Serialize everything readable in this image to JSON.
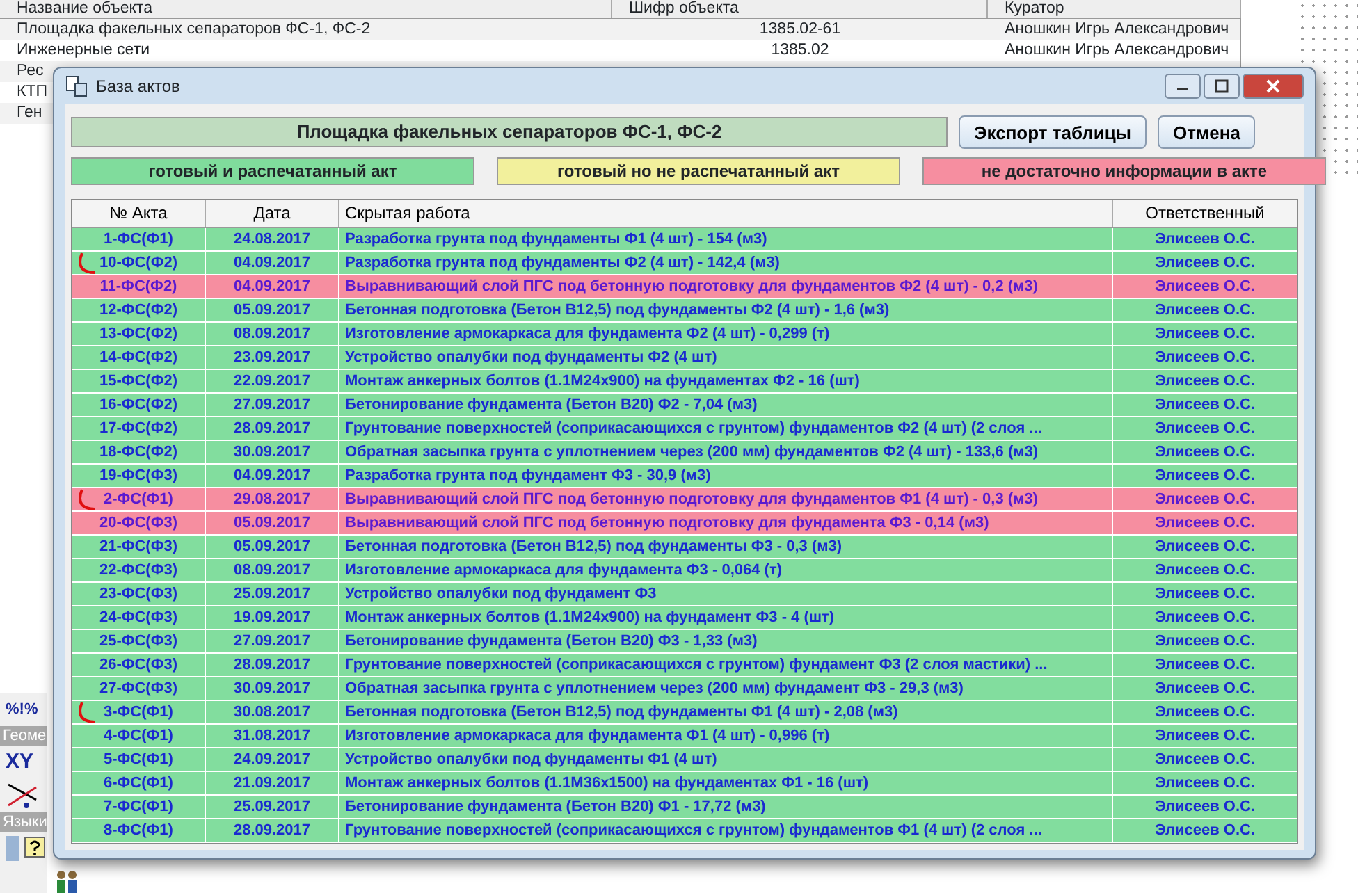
{
  "background_app": {
    "objects_table": {
      "columns": [
        "Название объекта",
        "Шифр объекта",
        "Куратор"
      ],
      "rows": [
        {
          "name": "Площадка факельных сепараторов ФС-1, ФС-2",
          "code": "1385.02-61",
          "curator": "Аношкин Игрь Александрович"
        },
        {
          "name": "Инженерные сети",
          "code": "1385.02",
          "curator": "Аношкин Игрь Александрович"
        },
        {
          "name": "Рес"
        },
        {
          "name": "КТП"
        },
        {
          "name": "Ген"
        }
      ]
    },
    "side_panel": {
      "formula_label": "%!%",
      "geometry_header": "Геоме",
      "xy_label": "XY",
      "languages_header": "Языки"
    }
  },
  "dialog": {
    "title": "База актов",
    "object_title": "Площадка факельных сепараторов ФС-1, ФС-2",
    "buttons": [
      "Экспорт таблицы",
      "Отмена"
    ],
    "legend": [
      {
        "label": "готовый и распечатанный акт",
        "color": "#80dc9c"
      },
      {
        "label": "готовый но не распечатанный акт",
        "color": "#f2f09c"
      },
      {
        "label": "не достаточно информации в акте",
        "color": "#f68ea0"
      }
    ],
    "table": {
      "columns": [
        "№ Акта",
        "Дата",
        "Скрытая работа",
        "Ответственный"
      ],
      "rows": [
        {
          "act": "1-ФС(Ф1)",
          "date": "24.08.2017",
          "work": "Разработка грунта под фундаменты Ф1 (4 шт) - 154 (м3)",
          "responsible": "Элисеев О.С.",
          "kind": "ready",
          "red_mark": false
        },
        {
          "act": "10-ФС(Ф2)",
          "date": "04.09.2017",
          "work": "Разработка грунта под фундаменты Ф2 (4 шт) - 142,4 (м3)",
          "responsible": "Элисеев О.С.",
          "kind": "ready",
          "red_mark": true
        },
        {
          "act": "11-ФС(Ф2)",
          "date": "04.09.2017",
          "work": "Выравнивающий слой ПГС под бетонную подготовку для фундаментов Ф2 (4 шт) - 0,2 (м3)",
          "responsible": "Элисеев О.С.",
          "kind": "insufficient",
          "red_mark": false
        },
        {
          "act": "12-ФС(Ф2)",
          "date": "05.09.2017",
          "work": "Бетонная подготовка (Бетон В12,5) под фундаменты Ф2 (4 шт) - 1,6 (м3)",
          "responsible": "Элисеев О.С.",
          "kind": "ready",
          "red_mark": false
        },
        {
          "act": "13-ФС(Ф2)",
          "date": "08.09.2017",
          "work": "Изготовление армокаркаса для фундамента Ф2 (4 шт) - 0,299 (т)",
          "responsible": "Элисеев О.С.",
          "kind": "ready",
          "red_mark": false
        },
        {
          "act": "14-ФС(Ф2)",
          "date": "23.09.2017",
          "work": "Устройство опалубки под фундаменты Ф2 (4 шт)",
          "responsible": "Элисеев О.С.",
          "kind": "ready",
          "red_mark": false
        },
        {
          "act": "15-ФС(Ф2)",
          "date": "22.09.2017",
          "work": "Монтаж анкерных болтов (1.1М24х900) на фундаментах Ф2 - 16 (шт)",
          "responsible": "Элисеев О.С.",
          "kind": "ready",
          "red_mark": false
        },
        {
          "act": "16-ФС(Ф2)",
          "date": "27.09.2017",
          "work": "Бетонирование фундамента (Бетон В20) Ф2 - 7,04 (м3)",
          "responsible": "Элисеев О.С.",
          "kind": "ready",
          "red_mark": false
        },
        {
          "act": "17-ФС(Ф2)",
          "date": "28.09.2017",
          "work": "Грунтование поверхностей (соприкасающихся с грунтом) фундаментов Ф2 (4 шт) (2 слоя ...",
          "responsible": "Элисеев О.С.",
          "kind": "ready",
          "red_mark": false
        },
        {
          "act": "18-ФС(Ф2)",
          "date": "30.09.2017",
          "work": "Обратная засыпка грунта с уплотнением через (200 мм) фундаментов Ф2 (4 шт) - 133,6 (м3)",
          "responsible": "Элисеев О.С.",
          "kind": "ready",
          "red_mark": false
        },
        {
          "act": "19-ФС(Ф3)",
          "date": "04.09.2017",
          "work": "Разработка грунта под фундамент Ф3 - 30,9 (м3)",
          "responsible": "Элисеев О.С.",
          "kind": "ready",
          "red_mark": false
        },
        {
          "act": "2-ФС(Ф1)",
          "date": "29.08.2017",
          "work": "Выравнивающий слой ПГС под бетонную подготовку для фундаментов Ф1 (4 шт) - 0,3 (м3)",
          "responsible": "Элисеев О.С.",
          "kind": "insufficient",
          "red_mark": true
        },
        {
          "act": "20-ФС(Ф3)",
          "date": "05.09.2017",
          "work": "Выравнивающий слой ПГС под бетонную подготовку для фундамента Ф3 - 0,14 (м3)",
          "responsible": "Элисеев О.С.",
          "kind": "insufficient",
          "red_mark": false
        },
        {
          "act": "21-ФС(Ф3)",
          "date": "05.09.2017",
          "work": "Бетонная подготовка (Бетон В12,5) под фундаменты Ф3 - 0,3 (м3)",
          "responsible": "Элисеев О.С.",
          "kind": "ready",
          "red_mark": false
        },
        {
          "act": "22-ФС(Ф3)",
          "date": "08.09.2017",
          "work": "Изготовление армокаркаса для фундамента Ф3 - 0,064 (т)",
          "responsible": "Элисеев О.С.",
          "kind": "ready",
          "red_mark": false
        },
        {
          "act": "23-ФС(Ф3)",
          "date": "25.09.2017",
          "work": "Устройство опалубки под фундамент Ф3",
          "responsible": "Элисеев О.С.",
          "kind": "ready",
          "red_mark": false
        },
        {
          "act": "24-ФС(Ф3)",
          "date": "19.09.2017",
          "work": "Монтаж анкерных болтов (1.1М24х900) на фундамент Ф3 - 4 (шт)",
          "responsible": "Элисеев О.С.",
          "kind": "ready",
          "red_mark": false
        },
        {
          "act": "25-ФС(Ф3)",
          "date": "27.09.2017",
          "work": "Бетонирование фундамента (Бетон В20) Ф3 - 1,33 (м3)",
          "responsible": "Элисеев О.С.",
          "kind": "ready",
          "red_mark": false
        },
        {
          "act": "26-ФС(Ф3)",
          "date": "28.09.2017",
          "work": "Грунтование поверхностей (соприкасающихся с грунтом) фундамент Ф3 (2 слоя мастики) ...",
          "responsible": "Элисеев О.С.",
          "kind": "ready",
          "red_mark": false
        },
        {
          "act": "27-ФС(Ф3)",
          "date": "30.09.2017",
          "work": "Обратная засыпка грунта с уплотнением через (200 мм) фундамент Ф3 - 29,3 (м3)",
          "responsible": "Элисеев О.С.",
          "kind": "ready",
          "red_mark": false
        },
        {
          "act": "3-ФС(Ф1)",
          "date": "30.08.2017",
          "work": "Бетонная подготовка (Бетон В12,5) под фундаменты Ф1 (4 шт) - 2,08 (м3)",
          "responsible": "Элисеев О.С.",
          "kind": "ready",
          "red_mark": true
        },
        {
          "act": "4-ФС(Ф1)",
          "date": "31.08.2017",
          "work": "Изготовление армокаркаса для фундамента Ф1 (4 шт) - 0,996 (т)",
          "responsible": "Элисеев О.С.",
          "kind": "ready",
          "red_mark": false
        },
        {
          "act": "5-ФС(Ф1)",
          "date": "24.09.2017",
          "work": "Устройство опалубки под фундаменты Ф1 (4 шт)",
          "responsible": "Элисеев О.С.",
          "kind": "ready",
          "red_mark": false
        },
        {
          "act": "6-ФС(Ф1)",
          "date": "21.09.2017",
          "work": "Монтаж анкерных болтов (1.1М36х1500) на фундаментах Ф1 - 16 (шт)",
          "responsible": "Элисеев О.С.",
          "kind": "ready",
          "red_mark": false
        },
        {
          "act": "7-ФС(Ф1)",
          "date": "25.09.2017",
          "work": "Бетонирование фундамента (Бетон В20) Ф1 - 17,72 (м3)",
          "responsible": "Элисеев О.С.",
          "kind": "ready",
          "red_mark": false
        },
        {
          "act": "8-ФС(Ф1)",
          "date": "28.09.2017",
          "work": "Грунтование поверхностей (соприкасающихся с грунтом) фундаментов Ф1 (4 шт) (2 слоя ...",
          "responsible": "Элисеев О.С.",
          "kind": "ready",
          "red_mark": false
        }
      ]
    }
  }
}
